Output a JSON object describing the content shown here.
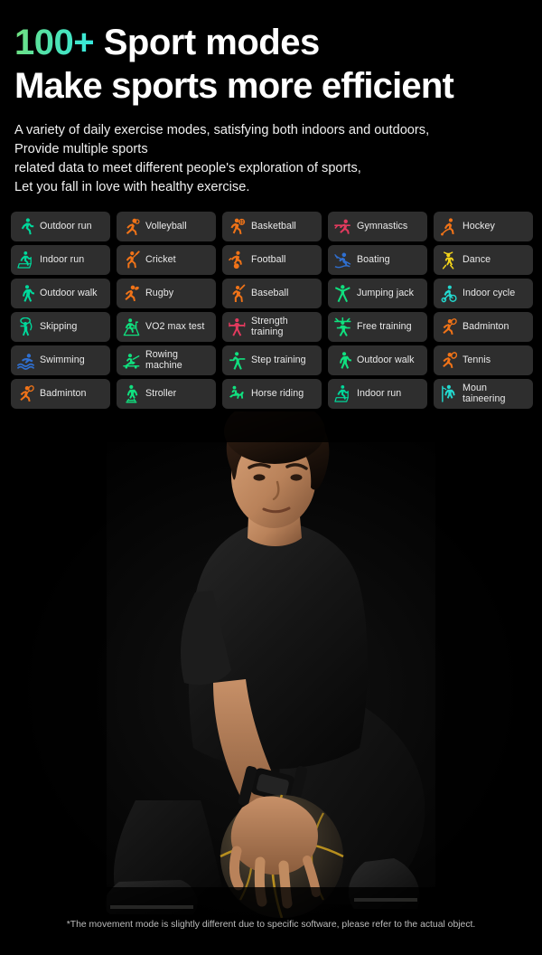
{
  "header": {
    "highlight": "100+",
    "headline1_rest": "Sport modes",
    "headline2": "Make sports more efficient",
    "sub_line1": "A variety of daily exercise modes, satisfying both indoors and outdoors,",
    "sub_line2": "Provide multiple sports",
    "sub_line3": "related data to meet different people's exploration of sports,",
    "sub_line4": "Let you fall in love with healthy exercise.",
    "gradient_from": "#72e07c",
    "gradient_to": "#35e9e2"
  },
  "colors": {
    "background": "#000000",
    "cell_background": "#2e2e2e",
    "label": "#e9e9e9",
    "teal": "#00d89b",
    "green": "#10e07f",
    "cyan": "#23d9cf",
    "orange": "#f07318",
    "blue": "#2f6fd0",
    "crimson": "#e23a5e",
    "yellow": "#f2d31a"
  },
  "grid": {
    "columns": 5,
    "rows": 7,
    "modes": [
      {
        "label": "Outdoor run",
        "icon": "running-icon",
        "color": "#00d89b"
      },
      {
        "label": "Volleyball",
        "icon": "volleyball-icon",
        "color": "#f07318"
      },
      {
        "label": "Basketball",
        "icon": "basketball-icon",
        "color": "#f07318"
      },
      {
        "label": "Gymnastics",
        "icon": "gymnastics-icon",
        "color": "#e23a5e"
      },
      {
        "label": "Hockey",
        "icon": "hockey-icon",
        "color": "#f07318"
      },
      {
        "label": "Indoor run",
        "icon": "treadmill-icon",
        "color": "#00d89b"
      },
      {
        "label": "Cricket",
        "icon": "cricket-icon",
        "color": "#f07318"
      },
      {
        "label": "Football",
        "icon": "football-icon",
        "color": "#f07318"
      },
      {
        "label": "Boating",
        "icon": "boating-icon",
        "color": "#2f6fd0"
      },
      {
        "label": "Dance",
        "icon": "dance-icon",
        "color": "#f2d31a"
      },
      {
        "label": "Outdoor walk",
        "icon": "walking-icon",
        "color": "#00d89b"
      },
      {
        "label": "Rugby",
        "icon": "rugby-icon",
        "color": "#f07318"
      },
      {
        "label": "Baseball",
        "icon": "baseball-icon",
        "color": "#f07318"
      },
      {
        "label": "Jumping jack",
        "icon": "jumping-jack-icon",
        "color": "#10e07f"
      },
      {
        "label": "Indoor cycle",
        "icon": "indoor-cycle-icon",
        "color": "#23d9cf"
      },
      {
        "label": "Skipping",
        "icon": "skipping-rope-icon",
        "color": "#00d89b"
      },
      {
        "label": "VO2 max test",
        "icon": "vo2-max-icon",
        "color": "#10e07f"
      },
      {
        "label": "Strength training",
        "icon": "strength-icon",
        "color": "#e23a5e"
      },
      {
        "label": "Free training",
        "icon": "free-training-icon",
        "color": "#10e07f"
      },
      {
        "label": "Badminton",
        "icon": "badminton-icon",
        "color": "#f07318"
      },
      {
        "label": "Swimming",
        "icon": "swimming-icon",
        "color": "#2f6fd0"
      },
      {
        "label": "Rowing machine",
        "icon": "rowing-machine-icon",
        "color": "#10e07f"
      },
      {
        "label": "Step training",
        "icon": "step-training-icon",
        "color": "#10e07f"
      },
      {
        "label": "Outdoor walk",
        "icon": "walking-icon",
        "color": "#10e07f"
      },
      {
        "label": "Tennis",
        "icon": "tennis-icon",
        "color": "#f07318"
      },
      {
        "label": "Badminton",
        "icon": "badminton-icon",
        "color": "#f07318"
      },
      {
        "label": "Stroller",
        "icon": "stroller-walk-icon",
        "color": "#10e07f"
      },
      {
        "label": "Horse riding",
        "icon": "horse-riding-icon",
        "color": "#10e07f"
      },
      {
        "label": "Indoor run",
        "icon": "treadmill-icon",
        "color": "#00d89b"
      },
      {
        "label": "Moun taineering",
        "icon": "mountaineering-icon",
        "color": "#23d9cf"
      }
    ]
  },
  "pagination": {
    "dot_count": 6
  },
  "photo": {
    "alt": "Athlete in black sportswear crouching with hand on a basketball, wearing a smartwatch"
  },
  "footer": {
    "note": "*The movement mode is slightly different due to specific software, please refer to the actual object."
  }
}
